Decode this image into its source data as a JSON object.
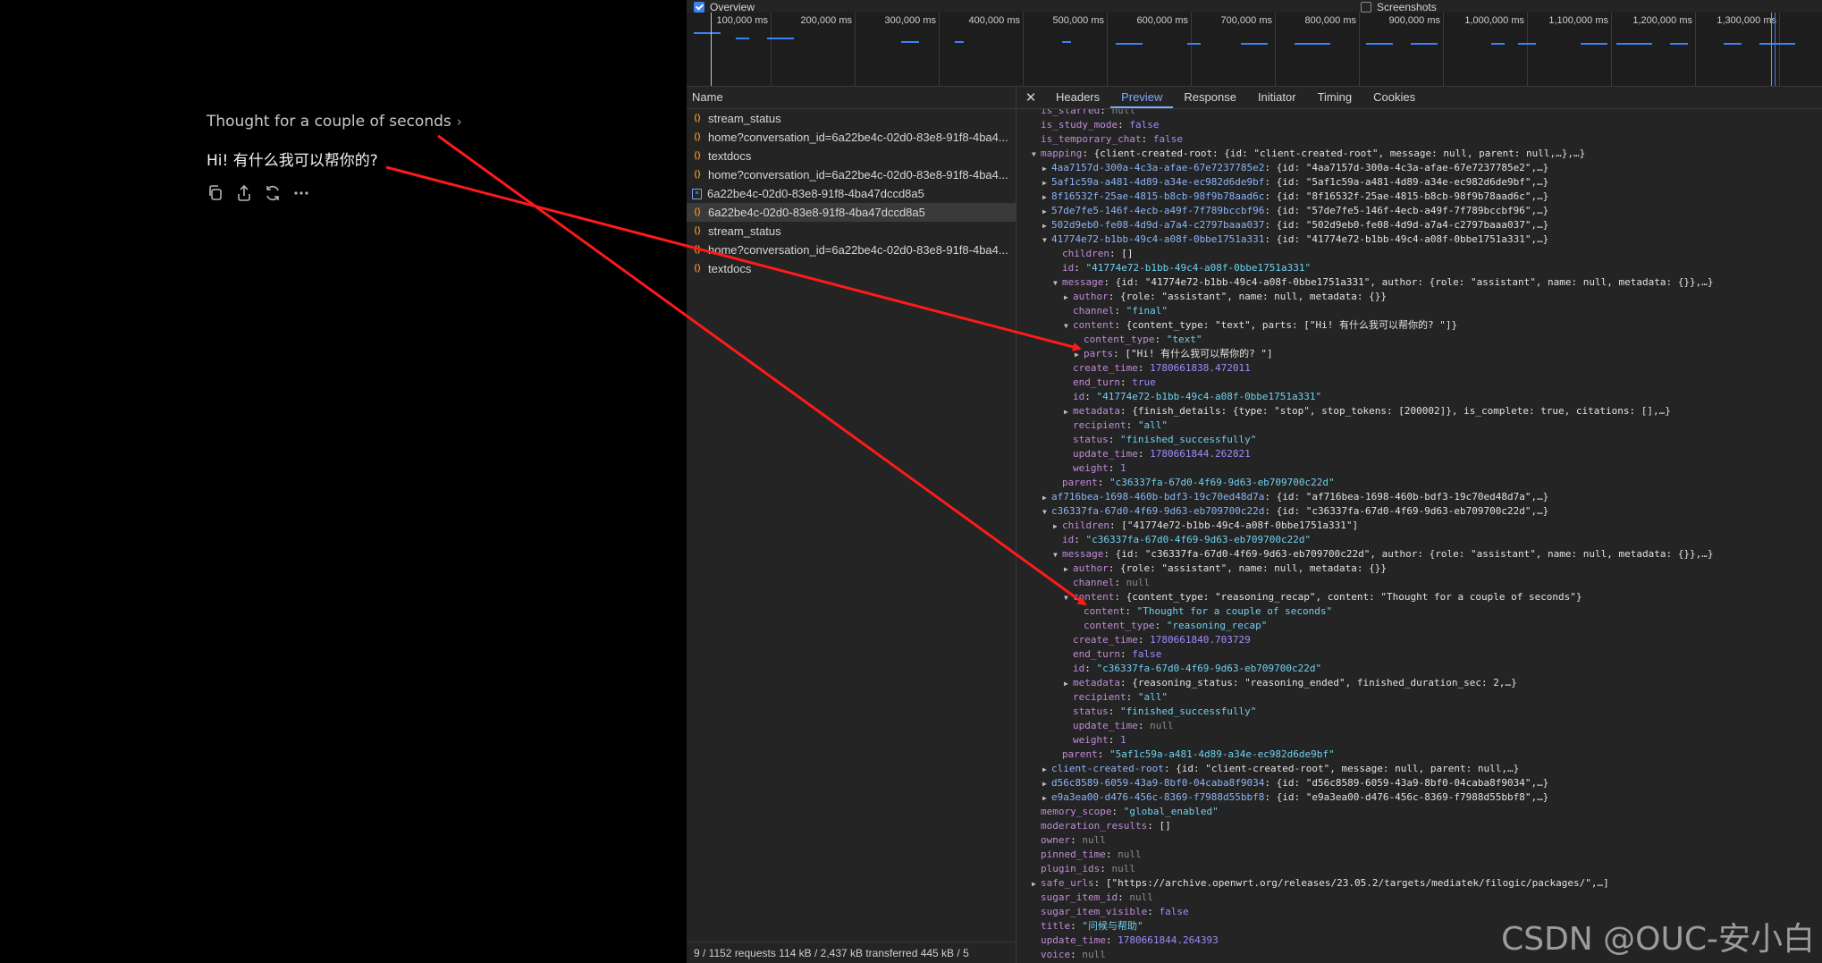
{
  "chat": {
    "thought_label": "Thought for a couple of seconds",
    "reply_text": "Hi! 有什么我可以帮你的?",
    "actions": [
      "copy-icon",
      "share-icon",
      "regenerate-icon",
      "more-icon"
    ]
  },
  "overview": {
    "overview_label": "Overview",
    "screenshots_label": "Screenshots"
  },
  "timeline": {
    "ticks": [
      "100,000 ms",
      "200,000 ms",
      "300,000 ms",
      "400,000 ms",
      "500,000 ms",
      "600,000 ms",
      "700,000 ms",
      "800,000 ms",
      "900,000 ms",
      "1,000,000 ms",
      "1,100,000 ms",
      "1,200,000 ms",
      "1,300,000 ms",
      "1,40"
    ]
  },
  "requests": {
    "header": "Name",
    "items": [
      {
        "name": "stream_status",
        "icon": "xhr"
      },
      {
        "name": "home?conversation_id=6a22be4c-02d0-83e8-91f8-4ba4...",
        "icon": "xhr"
      },
      {
        "name": "textdocs",
        "icon": "xhr"
      },
      {
        "name": "home?conversation_id=6a22be4c-02d0-83e8-91f8-4ba4...",
        "icon": "xhr"
      },
      {
        "name": "6a22be4c-02d0-83e8-91f8-4ba47dccd8a5",
        "icon": "doc"
      },
      {
        "name": "6a22be4c-02d0-83e8-91f8-4ba47dccd8a5",
        "icon": "xhr"
      },
      {
        "name": "stream_status",
        "icon": "xhr"
      },
      {
        "name": "home?conversation_id=6a22be4c-02d0-83e8-91f8-4ba4...",
        "icon": "xhr"
      },
      {
        "name": "textdocs",
        "icon": "xhr"
      }
    ],
    "status": "9 / 1152 requests   114 kB / 2,437 kB transferred   445 kB / 5"
  },
  "tabs": [
    "Headers",
    "Preview",
    "Response",
    "Initiator",
    "Timing",
    "Cookies"
  ],
  "active_tab": "Preview",
  "watermark": "CSDN @OUC-安小白",
  "colors": {
    "accent": "#7cacf8",
    "arrow": "#ff1a1a",
    "bar": "#3b82f6"
  },
  "tree": [
    {
      "t": 0,
      "k": "is_starred",
      "v": "null",
      "c": "nul"
    },
    {
      "t": 0,
      "k": "is_study_mode",
      "v": "false",
      "c": "bool"
    },
    {
      "t": 0,
      "k": "is_temporary_chat",
      "v": "false",
      "c": "bool"
    },
    {
      "t": 0,
      "e": "down",
      "k": "mapping",
      "v": "{client-created-root: {id: \"client-created-root\", message: null, parent: null,…},…}",
      "c": "v"
    },
    {
      "t": 1,
      "e": "right",
      "k": "4aa7157d-300a-4c3a-afae-67e7237785e2",
      "kc": "kn",
      "v": "{id: \"4aa7157d-300a-4c3a-afae-67e7237785e2\",…}",
      "c": "v"
    },
    {
      "t": 1,
      "e": "right",
      "k": "5af1c59a-a481-4d89-a34e-ec982d6de9bf",
      "kc": "kn",
      "v": "{id: \"5af1c59a-a481-4d89-a34e-ec982d6de9bf\",…}",
      "c": "v"
    },
    {
      "t": 1,
      "e": "right",
      "k": "8f16532f-25ae-4815-b8cb-98f9b78aad6c",
      "kc": "kn",
      "v": "{id: \"8f16532f-25ae-4815-b8cb-98f9b78aad6c\",…}",
      "c": "v"
    },
    {
      "t": 1,
      "e": "right",
      "k": "57de7fe5-146f-4ecb-a49f-7f789bccbf96",
      "kc": "kn",
      "v": "{id: \"57de7fe5-146f-4ecb-a49f-7f789bccbf96\",…}",
      "c": "v"
    },
    {
      "t": 1,
      "e": "right",
      "k": "502d9eb0-fe08-4d9d-a7a4-c2797baaa037",
      "kc": "kn",
      "v": "{id: \"502d9eb0-fe08-4d9d-a7a4-c2797baaa037\",…}",
      "c": "v"
    },
    {
      "t": 1,
      "e": "down",
      "k": "41774e72-b1bb-49c4-a08f-0bbe1751a331",
      "kc": "kn",
      "v": "{id: \"41774e72-b1bb-49c4-a08f-0bbe1751a331\",…}",
      "c": "v"
    },
    {
      "t": 2,
      "k": "children",
      "v": "[]",
      "c": "v"
    },
    {
      "t": 2,
      "k": "id",
      "v": "\"41774e72-b1bb-49c4-a08f-0bbe1751a331\"",
      "c": "s2"
    },
    {
      "t": 2,
      "e": "down",
      "k": "message",
      "v": "{id: \"41774e72-b1bb-49c4-a08f-0bbe1751a331\", author: {role: \"assistant\", name: null, metadata: {}},…}",
      "c": "v"
    },
    {
      "t": 3,
      "e": "right",
      "k": "author",
      "v": "{role: \"assistant\", name: null, metadata: {}}",
      "c": "v"
    },
    {
      "t": 3,
      "k": "channel",
      "v": "\"final\"",
      "c": "s2"
    },
    {
      "t": 3,
      "e": "down",
      "k": "content",
      "v": "{content_type: \"text\", parts: [\"Hi! 有什么我可以帮你的? \"]}",
      "c": "v"
    },
    {
      "t": 4,
      "k": "content_type",
      "v": "\"text\"",
      "c": "s2"
    },
    {
      "t": 4,
      "e": "right",
      "k": "parts",
      "v": "[\"Hi! 有什么我可以帮你的? \"]",
      "c": "v"
    },
    {
      "t": 3,
      "k": "create_time",
      "v": "1780661838.472011",
      "c": "num"
    },
    {
      "t": 3,
      "k": "end_turn",
      "v": "true",
      "c": "bool"
    },
    {
      "t": 3,
      "k": "id",
      "v": "\"41774e72-b1bb-49c4-a08f-0bbe1751a331\"",
      "c": "s2"
    },
    {
      "t": 3,
      "e": "right",
      "k": "metadata",
      "v": "{finish_details: {type: \"stop\", stop_tokens: [200002]}, is_complete: true, citations: [],…}",
      "c": "v"
    },
    {
      "t": 3,
      "k": "recipient",
      "v": "\"all\"",
      "c": "s2"
    },
    {
      "t": 3,
      "k": "status",
      "v": "\"finished_successfully\"",
      "c": "s2"
    },
    {
      "t": 3,
      "k": "update_time",
      "v": "1780661844.262821",
      "c": "num"
    },
    {
      "t": 3,
      "k": "weight",
      "v": "1",
      "c": "num"
    },
    {
      "t": 2,
      "k": "parent",
      "v": "\"c36337fa-67d0-4f69-9d63-eb709700c22d\"",
      "c": "s2"
    },
    {
      "t": 1,
      "e": "right",
      "k": "af716bea-1698-460b-bdf3-19c70ed48d7a",
      "kc": "kn",
      "v": "{id: \"af716bea-1698-460b-bdf3-19c70ed48d7a\",…}",
      "c": "v"
    },
    {
      "t": 1,
      "e": "down",
      "k": "c36337fa-67d0-4f69-9d63-eb709700c22d",
      "kc": "kn",
      "v": "{id: \"c36337fa-67d0-4f69-9d63-eb709700c22d\",…}",
      "c": "v"
    },
    {
      "t": 2,
      "e": "right",
      "k": "children",
      "v": "[\"41774e72-b1bb-49c4-a08f-0bbe1751a331\"]",
      "c": "v"
    },
    {
      "t": 2,
      "k": "id",
      "v": "\"c36337fa-67d0-4f69-9d63-eb709700c22d\"",
      "c": "s2"
    },
    {
      "t": 2,
      "e": "down",
      "k": "message",
      "v": "{id: \"c36337fa-67d0-4f69-9d63-eb709700c22d\", author: {role: \"assistant\", name: null, metadata: {}},…}",
      "c": "v"
    },
    {
      "t": 3,
      "e": "right",
      "k": "author",
      "v": "{role: \"assistant\", name: null, metadata: {}}",
      "c": "v"
    },
    {
      "t": 3,
      "k": "channel",
      "v": "null",
      "c": "nul"
    },
    {
      "t": 3,
      "e": "down",
      "k": "content",
      "v": "{content_type: \"reasoning_recap\", content: \"Thought for a couple of seconds\"}",
      "c": "v"
    },
    {
      "t": 4,
      "k": "content",
      "v": "\"Thought for a couple of seconds\"",
      "c": "s2"
    },
    {
      "t": 4,
      "k": "content_type",
      "v": "\"reasoning_recap\"",
      "c": "s2"
    },
    {
      "t": 3,
      "k": "create_time",
      "v": "1780661840.703729",
      "c": "num"
    },
    {
      "t": 3,
      "k": "end_turn",
      "v": "false",
      "c": "bool"
    },
    {
      "t": 3,
      "k": "id",
      "v": "\"c36337fa-67d0-4f69-9d63-eb709700c22d\"",
      "c": "s2"
    },
    {
      "t": 3,
      "e": "right",
      "k": "metadata",
      "v": "{reasoning_status: \"reasoning_ended\", finished_duration_sec: 2,…}",
      "c": "v"
    },
    {
      "t": 3,
      "k": "recipient",
      "v": "\"all\"",
      "c": "s2"
    },
    {
      "t": 3,
      "k": "status",
      "v": "\"finished_successfully\"",
      "c": "s2"
    },
    {
      "t": 3,
      "k": "update_time",
      "v": "null",
      "c": "nul"
    },
    {
      "t": 3,
      "k": "weight",
      "v": "1",
      "c": "num"
    },
    {
      "t": 2,
      "k": "parent",
      "v": "\"5af1c59a-a481-4d89-a34e-ec982d6de9bf\"",
      "c": "s2"
    },
    {
      "t": 1,
      "e": "right",
      "k": "client-created-root",
      "kc": "kn",
      "v": "{id: \"client-created-root\", message: null, parent: null,…}",
      "c": "v"
    },
    {
      "t": 1,
      "e": "right",
      "k": "d56c8589-6059-43a9-8bf0-04caba8f9034",
      "kc": "kn",
      "v": "{id: \"d56c8589-6059-43a9-8bf0-04caba8f9034\",…}",
      "c": "v"
    },
    {
      "t": 1,
      "e": "right",
      "k": "e9a3ea00-d476-456c-8369-f7988d55bbf8",
      "kc": "kn",
      "v": "{id: \"e9a3ea00-d476-456c-8369-f7988d55bbf8\",…}",
      "c": "v"
    },
    {
      "t": 0,
      "k": "memory_scope",
      "v": "\"global_enabled\"",
      "c": "s2"
    },
    {
      "t": 0,
      "k": "moderation_results",
      "v": "[]",
      "c": "v"
    },
    {
      "t": 0,
      "k": "owner",
      "v": "null",
      "c": "nul"
    },
    {
      "t": 0,
      "k": "pinned_time",
      "v": "null",
      "c": "nul"
    },
    {
      "t": 0,
      "k": "plugin_ids",
      "v": "null",
      "c": "nul"
    },
    {
      "t": 0,
      "e": "right",
      "k": "safe_urls",
      "v": "[\"https://archive.openwrt.org/releases/23.05.2/targets/mediatek/filogic/packages/\",…]",
      "c": "v"
    },
    {
      "t": 0,
      "k": "sugar_item_id",
      "v": "null",
      "c": "nul"
    },
    {
      "t": 0,
      "k": "sugar_item_visible",
      "v": "false",
      "c": "bool"
    },
    {
      "t": 0,
      "k": "title",
      "v": "\"问候与帮助\"",
      "c": "s2"
    },
    {
      "t": 0,
      "k": "update_time",
      "v": "1780661844.264393",
      "c": "num"
    },
    {
      "t": 0,
      "k": "voice",
      "v": "null",
      "c": "nul"
    }
  ]
}
